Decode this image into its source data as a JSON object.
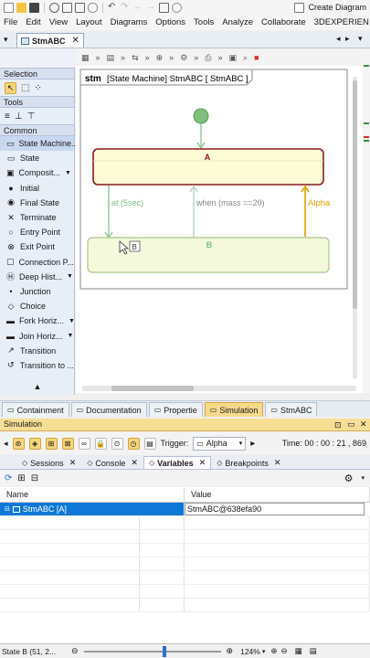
{
  "menu": [
    "File",
    "Edit",
    "View",
    "Layout",
    "Diagrams",
    "Options",
    "Tools",
    "Analyze",
    "Collaborate",
    "3DEXPERIEN"
  ],
  "toolbar": {
    "create_label": "Create Diagram"
  },
  "doc_tab": {
    "label": "StmABC"
  },
  "palette": {
    "selection_title": "Selection",
    "tools_title": "Tools",
    "common_title": "Common",
    "items": [
      {
        "label": "State Machine...",
        "icon": "state-machine-icon"
      },
      {
        "label": "State",
        "icon": "state-icon"
      },
      {
        "label": "Composit...",
        "icon": "composite-state-icon",
        "dropdown": true
      },
      {
        "label": "Initial",
        "icon": "initial-icon"
      },
      {
        "label": "Final State",
        "icon": "final-state-icon"
      },
      {
        "label": "Terminate",
        "icon": "terminate-icon"
      },
      {
        "label": "Entry Point",
        "icon": "entry-point-icon"
      },
      {
        "label": "Exit Point",
        "icon": "exit-point-icon"
      },
      {
        "label": "Connection P...",
        "icon": "connection-point-icon"
      },
      {
        "label": "Deep Hist...",
        "icon": "deep-history-icon",
        "dropdown": true
      },
      {
        "label": "Junction",
        "icon": "junction-icon"
      },
      {
        "label": "Choice",
        "icon": "choice-icon"
      },
      {
        "label": "Fork Horiz...",
        "icon": "fork-icon",
        "dropdown": true
      },
      {
        "label": "Join Horiz...",
        "icon": "join-icon",
        "dropdown": true
      },
      {
        "label": "Transition",
        "icon": "transition-icon"
      },
      {
        "label": "Transition to ...",
        "icon": "transition-to-self-icon"
      }
    ]
  },
  "diagram": {
    "kind": "stm",
    "frame_title": "[State Machine] StmABC [ StmABC ]",
    "state_a": "A",
    "state_b": "B",
    "t1_label": "at (5sec)",
    "t2_label": "when (mass ==20)",
    "t3_label": "Alpha",
    "badge_b": "B",
    "colors": {
      "active_border": "#8b1a1a",
      "active_fill": "#fdfcd7",
      "state_fill": "#f4f9dc",
      "state_border": "#a9c887",
      "initial": "#7fc07f",
      "transition": "#7cbf86",
      "trigger": "#e0a300"
    }
  },
  "bottom_tabs": [
    {
      "label": "Containment",
      "icon": "containment-icon",
      "active": false
    },
    {
      "label": "Documentation",
      "icon": "documentation-icon",
      "active": false
    },
    {
      "label": "Propertie",
      "icon": "properties-icon",
      "active": false
    },
    {
      "label": "Simulation",
      "icon": "simulation-icon",
      "active": true
    },
    {
      "label": "StmABC",
      "icon": "stm-icon",
      "active": false
    }
  ],
  "simulation": {
    "title": "Simulation",
    "trigger_label": "Trigger:",
    "trigger_value": "Alpha",
    "time_label": "Time: 00 : 00 : 21 , 869",
    "sub_tabs": [
      {
        "label": "Sessions",
        "active": false
      },
      {
        "label": "Console",
        "active": false
      },
      {
        "label": "Variables",
        "active": true
      },
      {
        "label": "Breakpoints",
        "active": false
      }
    ],
    "table": {
      "headers": [
        "Name",
        "Value"
      ],
      "rows": [
        {
          "name": "StmABC [A]",
          "value": "StmABC@638efa90"
        }
      ]
    }
  },
  "status": {
    "text": "State B (51, 2...",
    "zoom": "124%"
  }
}
